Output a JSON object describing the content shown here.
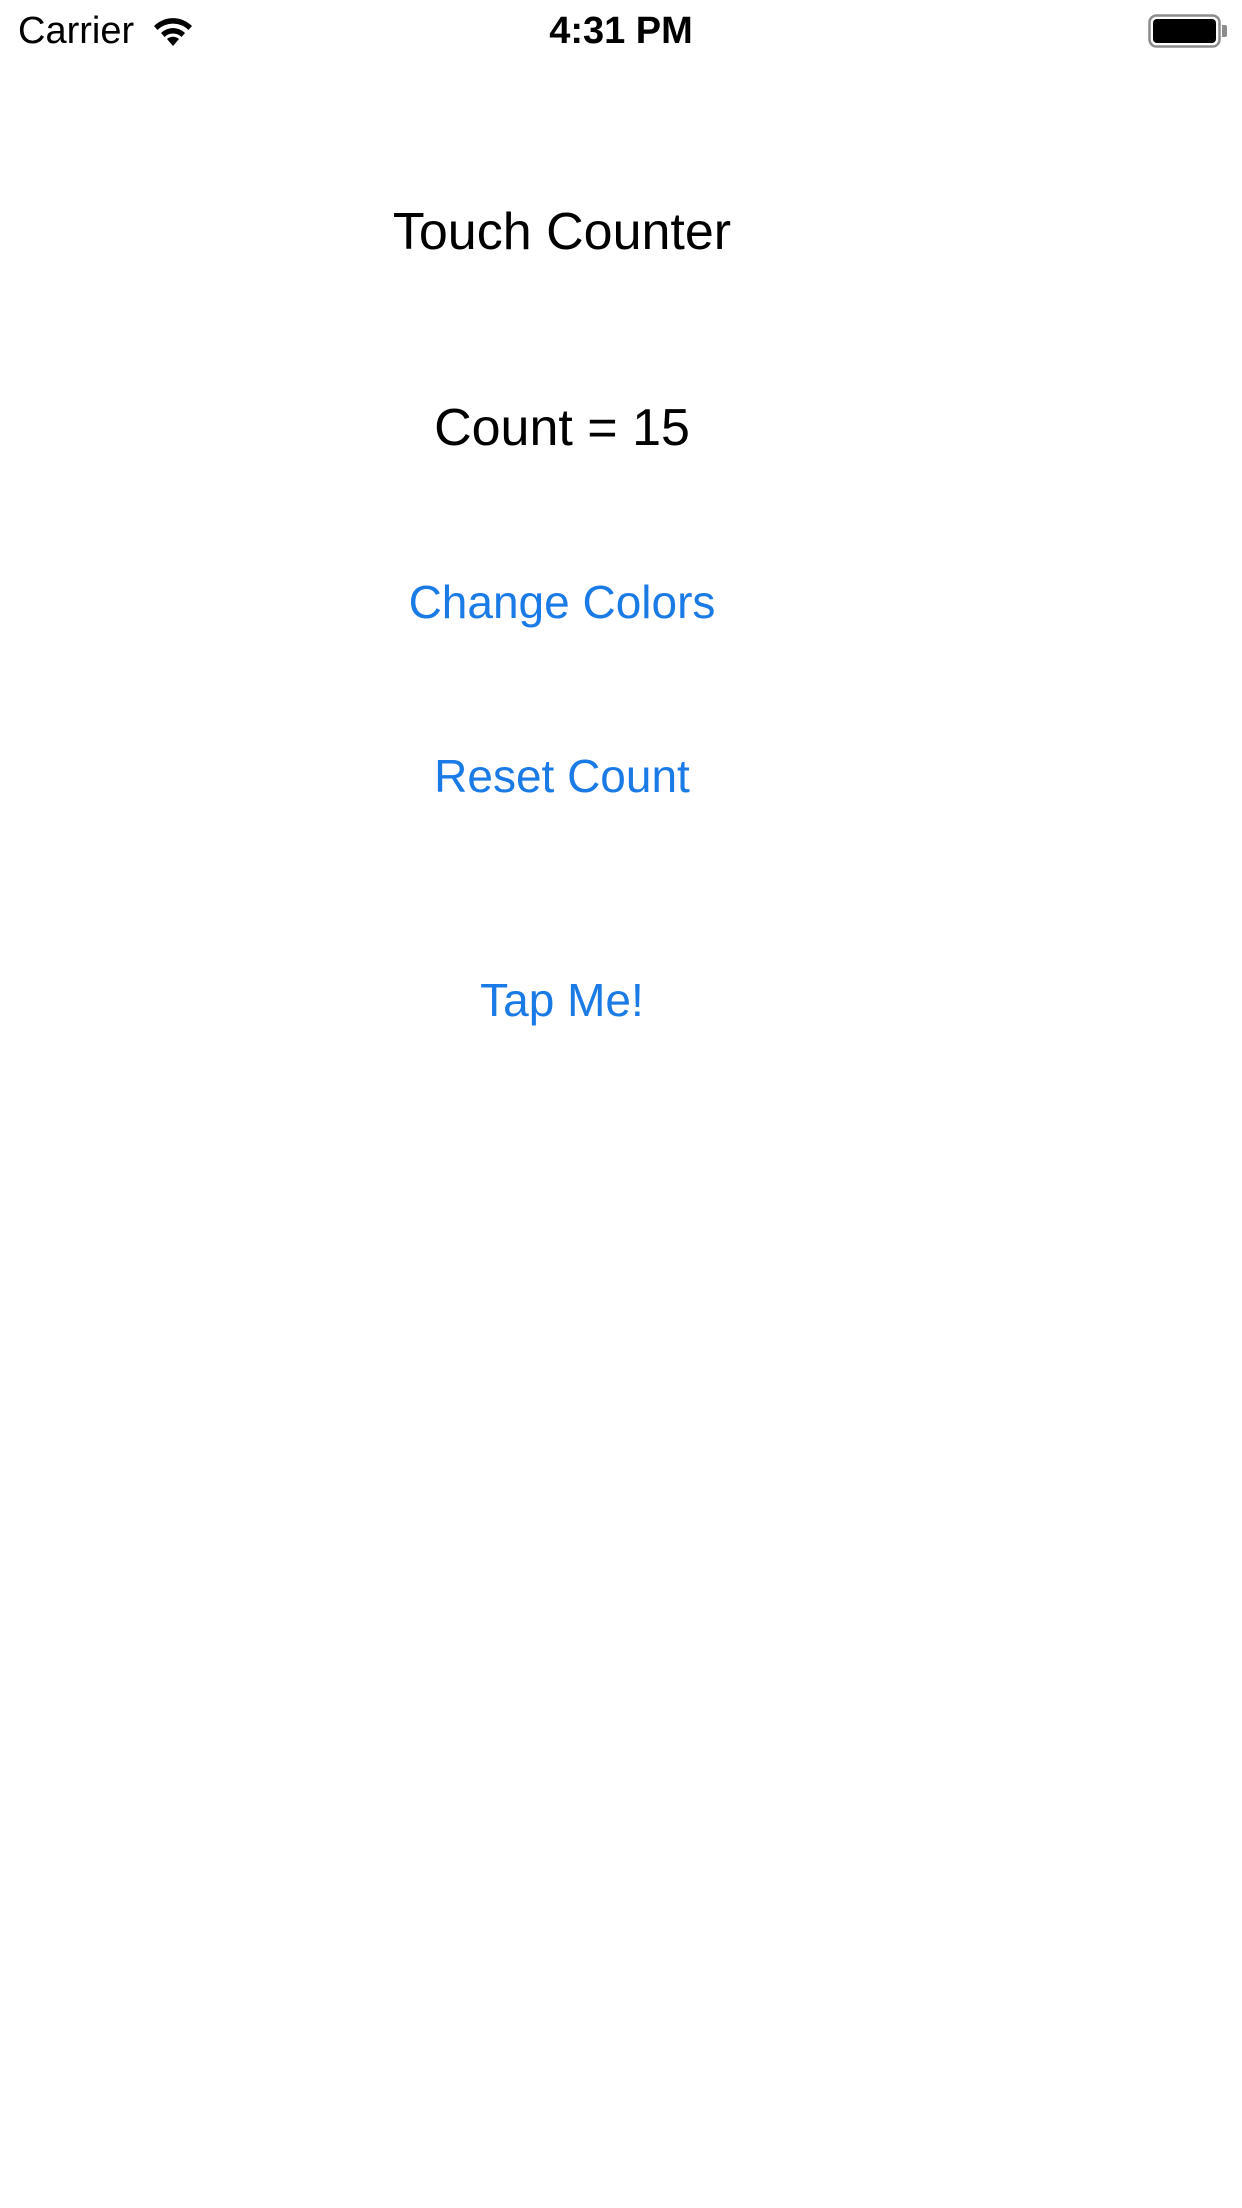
{
  "status_bar": {
    "carrier": "Carrier",
    "time": "4:31 PM",
    "wifi_icon": "wifi-icon",
    "battery_icon": "battery-icon"
  },
  "main": {
    "title": "Touch Counter",
    "count_text": "Count = 15",
    "change_colors_label": "Change Colors",
    "reset_count_label": "Reset Count",
    "tap_me_label": "Tap Me!"
  },
  "colors": {
    "background": "#ffffff",
    "text": "#000000",
    "accent": "#1a7ae6"
  }
}
